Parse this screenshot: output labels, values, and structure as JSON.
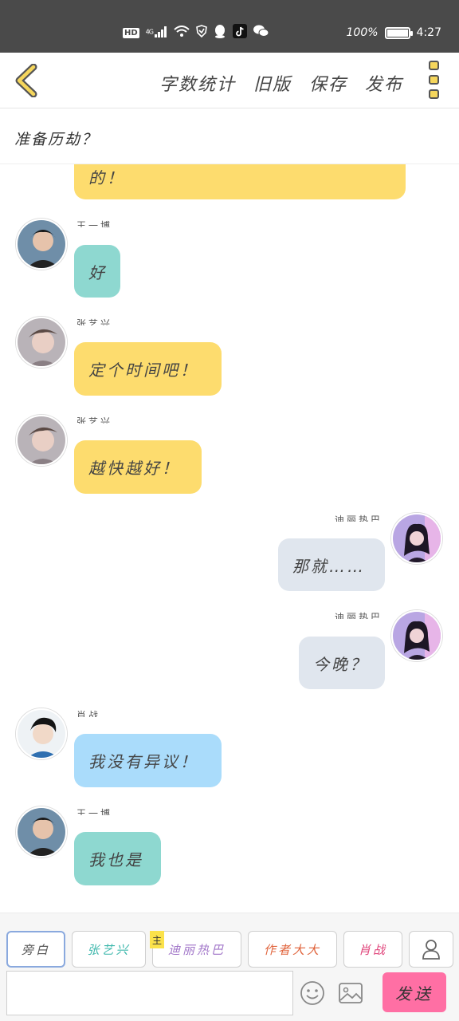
{
  "status_bar": {
    "hd": "HD",
    "network": "4G",
    "battery_percent_text": "100%",
    "battery_level": 1.0,
    "time": "4:27",
    "icons": [
      "hd-icon",
      "signal-icon",
      "wifi-icon",
      "vpn-shield-icon",
      "qq-icon",
      "tiktok-icon",
      "wechat-icon",
      "battery-icon"
    ]
  },
  "nav": {
    "back_icon": "chevron-left-icon",
    "word_count": "字数统计",
    "old_version": "旧版",
    "save": "保存",
    "publish": "发布",
    "more_icon": "more-vertical-icon"
  },
  "title": "准备历劫？",
  "messages": [
    {
      "side": "left",
      "color": "yellow",
      "text": "的！",
      "sender": ""
    },
    {
      "side": "left",
      "color": "teal",
      "text": "好",
      "sender": "王一博"
    },
    {
      "side": "left",
      "color": "yellow",
      "text": "定个时间吧！",
      "sender": "张艺兴"
    },
    {
      "side": "left",
      "color": "yellow",
      "text": "越快越好！",
      "sender": "张艺兴"
    },
    {
      "side": "right",
      "color": "gray",
      "text": "那就……",
      "sender": "迪丽热巴"
    },
    {
      "side": "right",
      "color": "gray",
      "text": "今晚？",
      "sender": "迪丽热巴"
    },
    {
      "side": "left",
      "color": "blue",
      "text": "我没有异议！",
      "sender": "肖战"
    },
    {
      "side": "left",
      "color": "teal",
      "text": "我也是",
      "sender": "王一博"
    }
  ],
  "roles": [
    {
      "label": "旁白",
      "color": "#555555",
      "active": true
    },
    {
      "label": "张艺兴",
      "color": "#3fb8ad"
    },
    {
      "label": "迪丽热巴",
      "color": "#a277c9",
      "tag": "主"
    },
    {
      "label": "作者大大",
      "color": "#e0633b"
    },
    {
      "label": "肖战",
      "color": "#e0457b"
    }
  ],
  "role_user_icon": "person-icon",
  "input": {
    "value": "",
    "placeholder": ""
  },
  "emoji_icon": "smiley-icon",
  "image_icon": "image-icon",
  "send_label": "发送",
  "colors": {
    "yellow": "#fddc6e",
    "teal": "#8ed8d0",
    "gray": "#e0e6ee",
    "blue": "#aadcfb",
    "send": "#ff6fa4"
  }
}
